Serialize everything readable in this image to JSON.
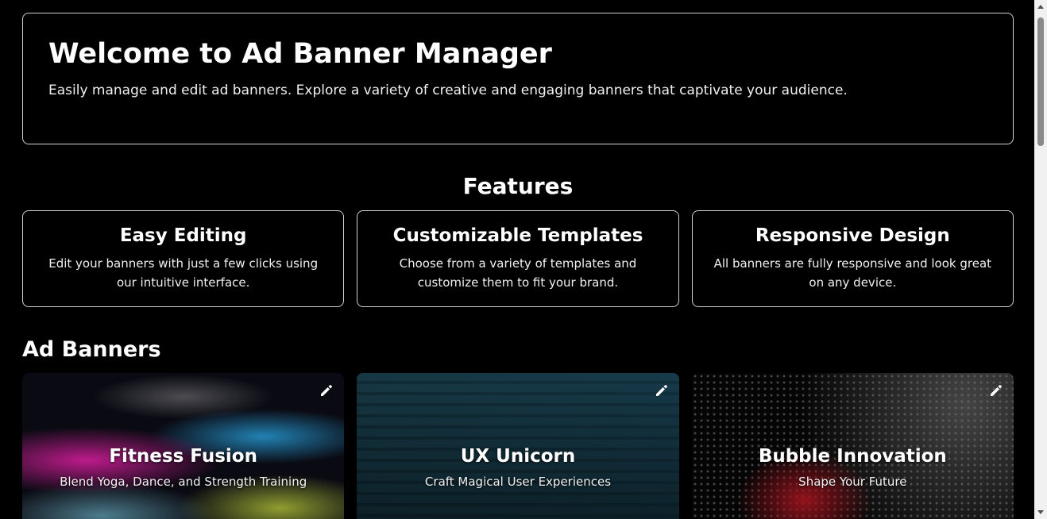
{
  "hero": {
    "title": "Welcome to Ad Banner Manager",
    "description": "Easily manage and edit ad banners. Explore a variety of creative and engaging banners that captivate your audience."
  },
  "features": {
    "title": "Features",
    "items": [
      {
        "title": "Easy Editing",
        "description": "Edit your banners with just a few clicks using our intuitive interface."
      },
      {
        "title": "Customizable Templates",
        "description": "Choose from a variety of templates and customize them to fit your brand."
      },
      {
        "title": "Responsive Design",
        "description": "All banners are fully responsive and look great on any device."
      }
    ]
  },
  "banners": {
    "title": "Ad Banners",
    "items": [
      {
        "title": "Fitness Fusion",
        "subtitle": "Blend Yoga, Dance, and Strength Training",
        "edit_icon": "pencil-icon"
      },
      {
        "title": "UX Unicorn",
        "subtitle": "Craft Magical User Experiences",
        "edit_icon": "pencil-icon"
      },
      {
        "title": "Bubble Innovation",
        "subtitle": "Shape Your Future",
        "edit_icon": "pencil-icon"
      }
    ]
  },
  "colors": {
    "background": "#000000",
    "border": "#d0d0d0",
    "text": "#ffffff",
    "cta_fill": "#7a1a20"
  }
}
